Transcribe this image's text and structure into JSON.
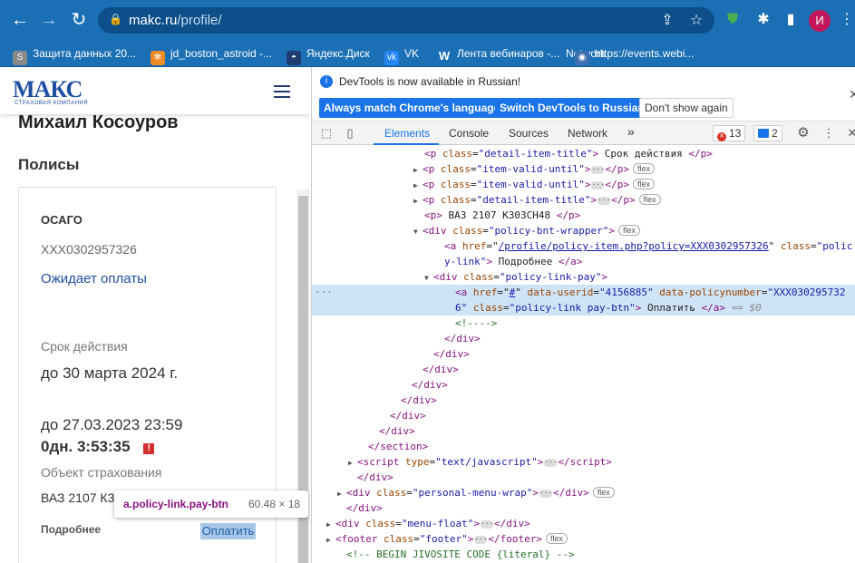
{
  "browser": {
    "url_host": "makc.ru",
    "url_path": "/profile/",
    "avatar_letter": "И"
  },
  "bookmarks": [
    {
      "label": "Защита данных 20...",
      "icon": "scalable-icon"
    },
    {
      "label": "jd_boston_astroid -...",
      "icon": "joomla-icon"
    },
    {
      "label": "Яндекс.Диск",
      "icon": "yandex-disk-icon"
    },
    {
      "label": "VK",
      "icon": "vk-icon"
    },
    {
      "label": "Лента вебинаров -...",
      "icon": "w-icon"
    },
    {
      "label": "Network",
      "icon": "w-icon"
    },
    {
      "label": "https://events.webi...",
      "icon": "globe-icon"
    }
  ],
  "site": {
    "logo": "МАКС",
    "logo_sub": "СТРАХОВАЯ КОМПАНИЯ",
    "user_name": "Михаил Косоуров",
    "section_title": "Полисы",
    "card": {
      "type": "ОСАГО",
      "number": "XXX0302957326",
      "status": "Ожидает оплаты",
      "validity_label": "Срок действия",
      "validity_value": "до 30 марта 2024 г.",
      "due_date": "до 27.03.2023 23:59",
      "countdown": "0дн. 3:53:35",
      "object_label": "Объект страхования",
      "object_value": "ВАЗ 2107 К3",
      "more_link": "Подробнее",
      "pay_link": "Оплатить"
    },
    "tooltip": {
      "selector": "a.policy-link.pay-btn",
      "size": "60.48 × 18"
    }
  },
  "devtools": {
    "info_text": "DevTools is now available in Russian!",
    "btn_match": "Always match Chrome's language",
    "btn_switch": "Switch DevTools to Russian",
    "btn_dont": "Don't show again",
    "tabs": [
      "Elements",
      "Console",
      "Sources",
      "Network"
    ],
    "more_tabs": "»",
    "errors": "13",
    "messages": "2"
  },
  "code_lines": [
    {
      "ind": 124,
      "tri": "",
      "html": "<span class='t-tag'>&lt;p</span> <span class='t-attr'>class</span>=<span class='t-val'>\"detail-item-title\"</span><span class='t-tag'>&gt;</span> Срок действия <span class='t-tag'>&lt;/p&gt;</span>"
    },
    {
      "ind": 124,
      "tri": "▶",
      "html": "<span class='t-tag'>&lt;p</span> <span class='t-attr'>class</span>=<span class='t-val'>\"item-valid-until\"</span><span class='t-tag'>&gt;</span><span class='ell'>···</span><span class='t-tag'>&lt;/p&gt;</span><span class='flex'>flex</span>"
    },
    {
      "ind": 124,
      "tri": "▶",
      "html": "<span class='t-tag'>&lt;p</span> <span class='t-attr'>class</span>=<span class='t-val'>\"item-valid-until\"</span><span class='t-tag'>&gt;</span><span class='ell'>···</span><span class='t-tag'>&lt;/p&gt;</span><span class='flex'>flex</span>"
    },
    {
      "ind": 124,
      "tri": "▶",
      "html": "<span class='t-tag'>&lt;p</span> <span class='t-attr'>class</span>=<span class='t-val'>\"detail-item-title\"</span><span class='t-tag'>&gt;</span><span class='ell'>···</span><span class='t-tag'>&lt;/p&gt;</span><span class='flex'>flex</span>"
    },
    {
      "ind": 124,
      "tri": "",
      "html": "<span class='t-tag'>&lt;p&gt;</span> ВАЗ 2107 К303СН48 <span class='t-tag'>&lt;/p&gt;</span>"
    },
    {
      "ind": 124,
      "tri": "▼",
      "html": "<span class='t-tag'>&lt;div</span> <span class='t-attr'>class</span>=<span class='t-val'>\"policy-bnt-wrapper\"</span><span class='t-tag'>&gt;</span><span class='flex'>flex</span>"
    },
    {
      "ind": 146,
      "tri": "",
      "html": "<span class='t-tag'>&lt;a</span> <span class='t-attr'>href</span>=\"<span class='t-link'>/profile/policy-item.php?policy=XXX0302957326</span>\" <span class='t-attr'>class</span>=<span class='t-val'>\"polic</span>"
    },
    {
      "ind": 146,
      "tri": "",
      "html": "<span class='t-val'>y-link\"</span><span class='t-tag'>&gt;</span> Подробнее <span class='t-tag'>&lt;/a&gt;</span>"
    },
    {
      "ind": 136,
      "tri": "▼",
      "html": "<span class='t-tag'>&lt;div</span> <span class='t-attr'>class</span>=<span class='t-val'>\"policy-link-pay\"</span><span class='t-tag'>&gt;</span>"
    },
    {
      "ind": 158,
      "tri": "",
      "hl": true,
      "html": "<span class='t-tag'>&lt;a</span> <span class='t-attr'>href</span>=\"<span class='t-link'>#</span>\" <span class='t-attr'>data-userid</span>=<span class='t-val'>\"4156885\"</span> <span class='t-attr'>data-policynumber</span>=<span class='t-val'>\"XXX030295732</span>"
    },
    {
      "ind": 158,
      "tri": "",
      "hl": true,
      "html": "<span class='t-val'>6\"</span> <span class='t-attr'>class</span>=<span class='t-val'>\"policy-link pay-btn\"</span><span class='t-tag'>&gt;</span> Оплатить <span class='t-tag'>&lt;/a&gt;</span> <span class='t-gray'>== $0</span>"
    },
    {
      "ind": 158,
      "tri": "",
      "html": "<span class='t-cm'>&lt;!----&gt;</span>"
    },
    {
      "ind": 146,
      "tri": "",
      "html": "<span class='t-tag'>&lt;/div&gt;</span>"
    },
    {
      "ind": 134,
      "tri": "",
      "html": "<span class='t-tag'>&lt;/div&gt;</span>"
    },
    {
      "ind": 122,
      "tri": "",
      "html": "<span class='t-tag'>&lt;/div&gt;</span>"
    },
    {
      "ind": 110,
      "tri": "",
      "html": "<span class='t-tag'>&lt;/div&gt;</span>"
    },
    {
      "ind": 98,
      "tri": "",
      "html": "<span class='t-tag'>&lt;/div&gt;</span>"
    },
    {
      "ind": 86,
      "tri": "",
      "html": "<span class='t-tag'>&lt;/div&gt;</span>"
    },
    {
      "ind": 74,
      "tri": "",
      "html": "<span class='t-tag'>&lt;/div&gt;</span>"
    },
    {
      "ind": 62,
      "tri": "",
      "html": "<span class='t-tag'>&lt;/section&gt;</span>"
    },
    {
      "ind": 52,
      "tri": "▶",
      "html": "<span class='t-tag'>&lt;script</span> <span class='t-attr'>type</span>=<span class='t-val'>\"text/javascript\"</span><span class='t-tag'>&gt;</span><span class='ell'>···</span><span class='t-tag'>&lt;/script&gt;</span>"
    },
    {
      "ind": 50,
      "tri": "",
      "html": "<span class='t-tag'>&lt;/div&gt;</span>"
    },
    {
      "ind": 40,
      "tri": "▶",
      "html": "<span class='t-tag'>&lt;div</span> <span class='t-attr'>class</span>=<span class='t-val'>\"personal-menu-wrap\"</span><span class='t-tag'>&gt;</span><span class='ell'>···</span><span class='t-tag'>&lt;/div&gt;</span><span class='flex'>flex</span>"
    },
    {
      "ind": 38,
      "tri": "",
      "html": "<span class='t-tag'>&lt;/div&gt;</span>"
    },
    {
      "ind": 28,
      "tri": "▶",
      "html": "<span class='t-tag'>&lt;div</span> <span class='t-attr'>class</span>=<span class='t-val'>\"menu-float\"</span><span class='t-tag'>&gt;</span><span class='ell'>···</span><span class='t-tag'>&lt;/div&gt;</span>"
    },
    {
      "ind": 28,
      "tri": "▶",
      "html": "<span class='t-tag'>&lt;footer</span> <span class='t-attr'>class</span>=<span class='t-val'>\"footer\"</span><span class='t-tag'>&gt;</span><span class='ell'>···</span><span class='t-tag'>&lt;/footer&gt;</span><span class='flex'>flex</span>"
    },
    {
      "ind": 38,
      "tri": "",
      "html": "<span class='t-cm'>&lt;!-- BEGIN JIVOSITE CODE {literal} --&gt;</span>"
    }
  ]
}
